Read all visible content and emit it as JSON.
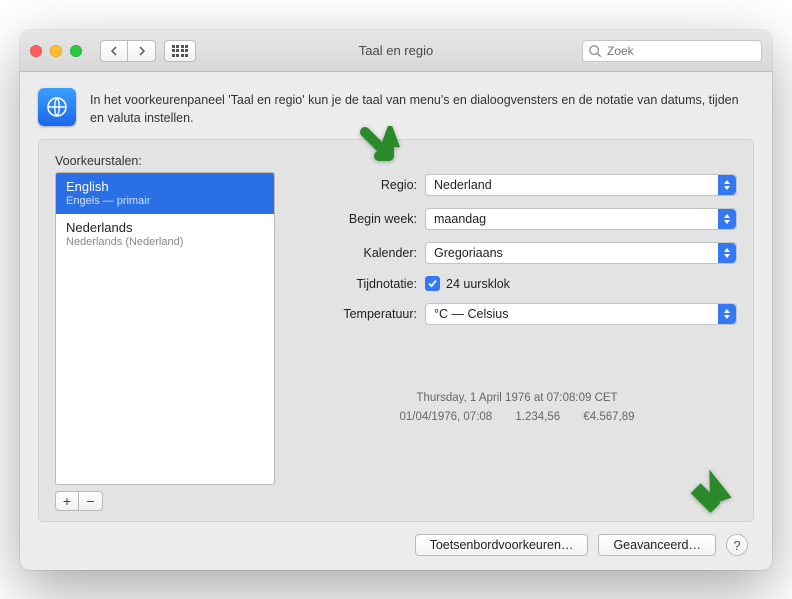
{
  "window": {
    "title": "Taal en regio",
    "search_placeholder": "Zoek"
  },
  "intro": {
    "text": "In het voorkeurenpaneel 'Taal en regio' kun je de taal van menu's en dialoogvensters en de notatie van datums, tijden en valuta instellen."
  },
  "languages": {
    "label": "Voorkeurstalen:",
    "items": [
      {
        "primary": "English",
        "secondary": "Engels — primair"
      },
      {
        "primary": "Nederlands",
        "secondary": "Nederlands (Nederland)"
      }
    ]
  },
  "settings": {
    "region": {
      "label": "Regio:",
      "value": "Nederland"
    },
    "firstday": {
      "label": "Begin week:",
      "value": "maandag"
    },
    "calendar": {
      "label": "Kalender:",
      "value": "Gregoriaans"
    },
    "timeformat": {
      "label": "Tijdnotatie:",
      "checkbox_label": "24 uursklok"
    },
    "temperature": {
      "label": "Temperatuur:",
      "value": "°C — Celsius"
    }
  },
  "example": {
    "line1": "Thursday, 1 April 1976 at 07:08:09 CET",
    "line2_a": "01/04/1976, 07:08",
    "line2_b": "1.234,56",
    "line2_c": "€4.567,89"
  },
  "footer": {
    "keyboard": "Toetsenbordvoorkeuren…",
    "advanced": "Geavanceerd…",
    "help": "?"
  }
}
